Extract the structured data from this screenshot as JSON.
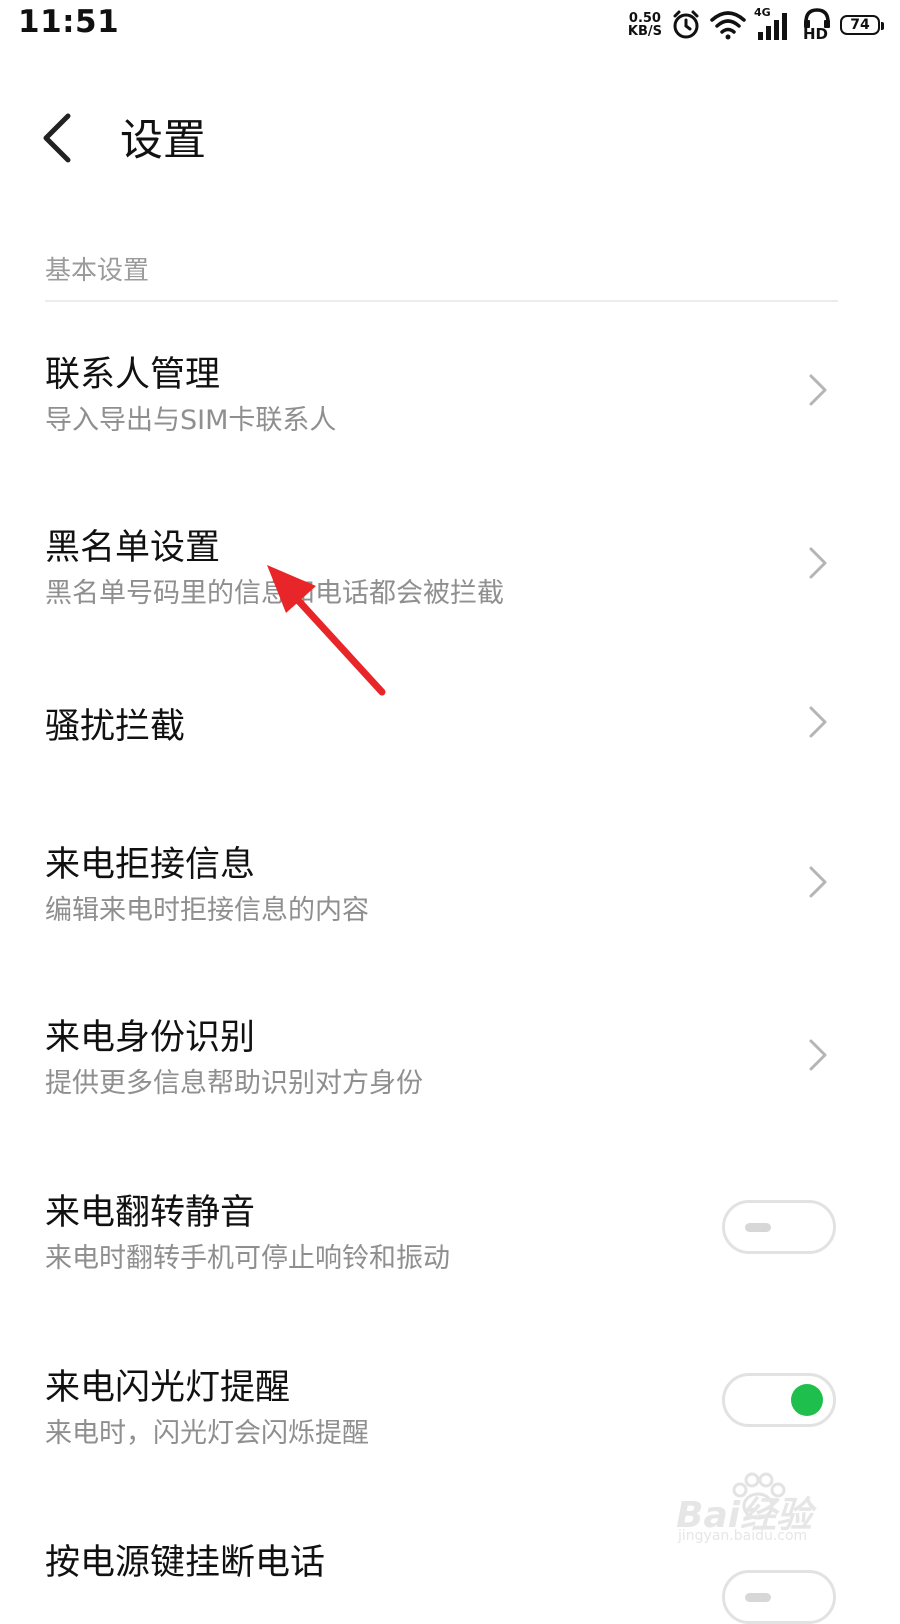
{
  "status_bar": {
    "time": "11:51",
    "net_speed_value": "0.50",
    "net_speed_unit": "KB/S",
    "network_type": "4G",
    "hd_label": "HD",
    "battery_level": "74",
    "icons": [
      "alarm-icon",
      "wifi-icon",
      "signal-icon",
      "hd-call-icon",
      "battery-icon"
    ]
  },
  "header": {
    "title": "设置",
    "back_icon": "back-arrow-icon"
  },
  "section": {
    "header": "基本设置"
  },
  "items": [
    {
      "title": "联系人管理",
      "subtitle": "导入导出与SIM卡联系人",
      "control": "chevron"
    },
    {
      "title": "黑名单设置",
      "subtitle": "黑名单号码里的信息和电话都会被拦截",
      "control": "chevron"
    },
    {
      "title": "骚扰拦截",
      "subtitle": "",
      "control": "chevron"
    },
    {
      "title": "来电拒接信息",
      "subtitle": "编辑来电时拒接信息的内容",
      "control": "chevron"
    },
    {
      "title": "来电身份识别",
      "subtitle": "提供更多信息帮助识别对方身份",
      "control": "chevron"
    },
    {
      "title": "来电翻转静音",
      "subtitle": "来电时翻转手机可停止响铃和振动",
      "control": "toggle",
      "on": false
    },
    {
      "title": "来电闪光灯提醒",
      "subtitle": "来电时，闪光灯会闪烁提醒",
      "control": "toggle",
      "on": true
    },
    {
      "title": "按电源键挂断电话",
      "subtitle": "",
      "control": "toggle",
      "on": false
    }
  ],
  "colors": {
    "accent_green": "#1fbf4d",
    "annotation_arrow": "#e8262a",
    "subtitle_gray": "#8f8f8f"
  },
  "watermark": {
    "brand": "Bai经验",
    "url": "jingyan.baidu.com"
  }
}
